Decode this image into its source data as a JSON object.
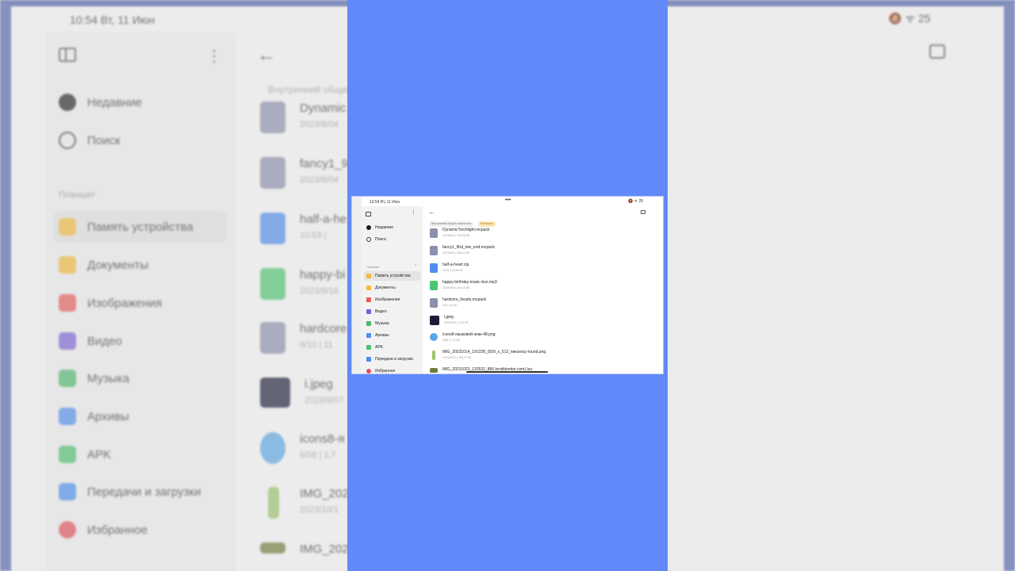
{
  "colors": {
    "panel_blue": "#6189f9",
    "folder": "#f4b93a",
    "docs": "#f4b93a",
    "images": "#e85b55",
    "video": "#7b61d6",
    "music": "#4cb86c",
    "archives": "#4f8ef0",
    "apk": "#4cc06d",
    "transfers": "#4a8ef0",
    "favorites": "#e54d5a",
    "pack_icon": "#8d8fae",
    "zip_icon": "#4f8ef0",
    "mp3_icon": "#4cc873"
  },
  "status": {
    "time_date": "10:54  Вт, 11 Июн",
    "icons_right": "🔕 ᯤ 25"
  },
  "sidebar": {
    "recent": "Недавние",
    "search": "Поиск",
    "section": "Планшет",
    "items": [
      {
        "label": "Память устройства",
        "icon": "folder-icon"
      },
      {
        "label": "Документы",
        "icon": "document-icon"
      },
      {
        "label": "Изображения",
        "icon": "image-icon"
      },
      {
        "label": "Видео",
        "icon": "video-icon"
      },
      {
        "label": "Музыка",
        "icon": "music-icon"
      },
      {
        "label": "Архивы",
        "icon": "archive-icon"
      },
      {
        "label": "APK",
        "icon": "apk-icon"
      },
      {
        "label": "Передачи и загрузки",
        "icon": "transfer-icon"
      },
      {
        "label": "Избранное",
        "icon": "heart-icon"
      }
    ]
  },
  "main": {
    "breadcrumb_root": "Внутренний общий накопитель",
    "breadcrumb_current": "Download",
    "files": [
      {
        "name": "DynamicTorchlight.mcpack",
        "meta": "2023/8/04  |  702,26 КБ",
        "icon": "pack-file-icon"
      },
      {
        "name": "fancy1_9hd_low_end.mcpack",
        "meta": "2023/8/04  |  356,13 КБ",
        "icon": "pack-file-icon"
      },
      {
        "name": "half-a-heart.zip",
        "meta": "10:53  |  18,56 КБ",
        "icon": "zip-file-icon"
      },
      {
        "name": "happy-birthday-music-box.mp3",
        "meta": "2023/9/16  |  463,16 КБ",
        "icon": "mp3-file-icon"
      },
      {
        "name": "hardcore_hearts.mcpack",
        "meta": "6/10  |  11 КБ",
        "icon": "pack-file-icon"
      },
      {
        "name": "i.jpeg",
        "meta": "2023/9/07  |  3,92 КБ",
        "icon": "image-thumb-icon"
      },
      {
        "name": "icons8-языковой-знак-48.png",
        "meta": "6/08  |  1,72 КБ",
        "icon": "png-file-icon"
      },
      {
        "name": "IMG_20231014_191228_(509_x_512_пиксель)-round.png",
        "meta": "2023/10/14  |  263,07 КБ",
        "icon": "plant-thumb-icon"
      },
      {
        "name": "IMG_20231023_132532_866.lorotblembo.com).lou",
        "meta": "",
        "icon": "landscape-thumb-icon"
      }
    ]
  },
  "bg": {
    "recent": "Недавние",
    "search": "Поиск",
    "section": "Планшет",
    "items": [
      "Память устройства",
      "Документы",
      "Изображения",
      "Видео",
      "Музыка",
      "Архивы",
      "APK",
      "Передачи и загрузки",
      "Избранное"
    ],
    "crumb": "Внутренний общий н",
    "files": [
      {
        "name": "Dynamic",
        "meta": "2023/8/04"
      },
      {
        "name": "fancy1_9",
        "meta": "2023/8/04"
      },
      {
        "name": "half-a-he",
        "meta": "10:53  |"
      },
      {
        "name": "happy-bi",
        "meta": "2023/9/16"
      },
      {
        "name": "hardcore",
        "meta": "6/10  |  11"
      },
      {
        "name": "i.jpeg",
        "meta": "2023/9/07"
      },
      {
        "name": "icons8-я",
        "meta": "6/08  |  1,7"
      },
      {
        "name": "IMG_202",
        "meta": "2023/10/1"
      },
      {
        "name": "IMG_202",
        "meta": ""
      }
    ],
    "status_time": "10:54  Вт, 11 Июн"
  }
}
